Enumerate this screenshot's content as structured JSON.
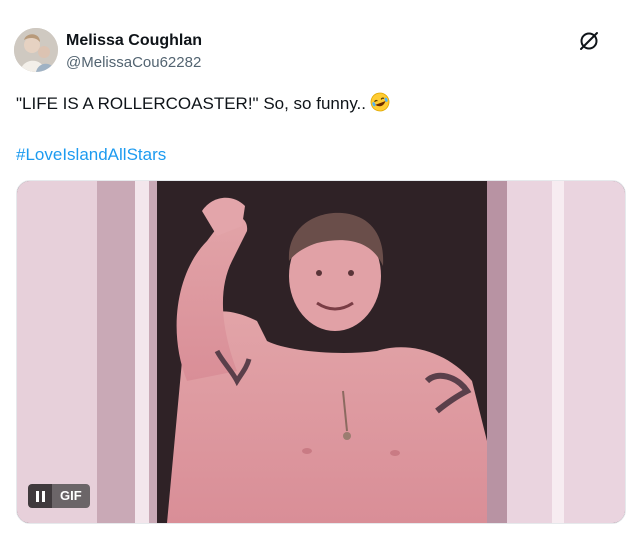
{
  "author": {
    "name": "Melissa Coughlan",
    "handle": "@MelissaCou62282",
    "avatar_icon": "profile-photo"
  },
  "platform_icon": "x-logo-icon",
  "tweet": {
    "text": "\"LIFE IS A ROLLERCOASTER!\" So, so funny..",
    "emoji": "rolling-on-floor-laughing-emoji",
    "hashtag": "#LoveIslandAllStars"
  },
  "media": {
    "type": "gif",
    "badge_label": "GIF",
    "control_icon": "pause-icon"
  },
  "colors": {
    "link": "#1d9bf0",
    "text": "#0f1419",
    "secondary": "#536471"
  }
}
